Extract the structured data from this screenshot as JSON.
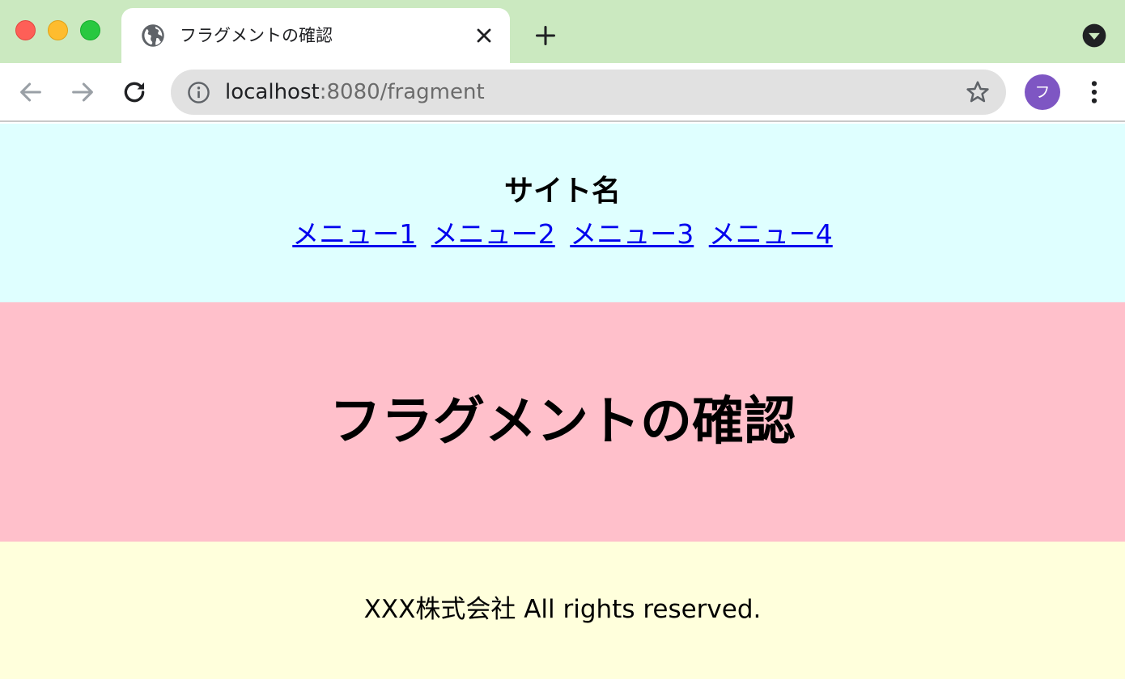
{
  "browser": {
    "tab": {
      "title": "フラグメントの確認",
      "favicon": "globe-icon"
    },
    "new_tab_icon": "plus-icon",
    "tab_search_icon": "chevron-down-icon",
    "address_bar": {
      "host": "localhost",
      "rest": ":8080/fragment",
      "info_icon": "info-icon",
      "bookmark_icon": "star-icon"
    },
    "profile": {
      "initial": "フ",
      "color": "#7e56c3"
    },
    "menu_icon": "more-vert-icon",
    "colors": {
      "frame": "#cbe9c0",
      "omnibox": "#e1e1e1"
    }
  },
  "page": {
    "header": {
      "site_name": "サイト名",
      "menu": [
        "メニュー1",
        "メニュー2",
        "メニュー3",
        "メニュー4"
      ],
      "background": "#dfffff"
    },
    "main": {
      "heading": "フラグメントの確認",
      "background": "#ffc0cb"
    },
    "footer": {
      "copyright": "XXX株式会社 All rights reserved.",
      "background": "#ffffdc"
    }
  }
}
